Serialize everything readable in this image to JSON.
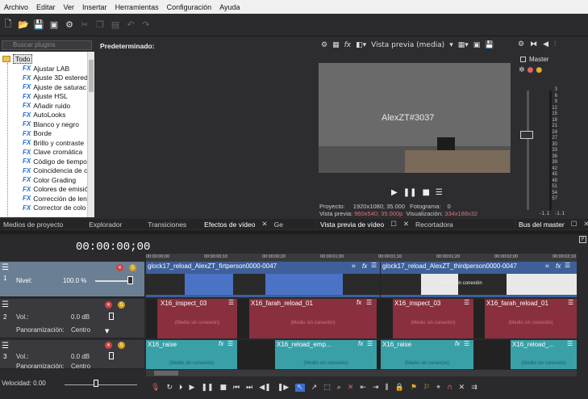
{
  "menu": [
    "Archivo",
    "Editar",
    "Ver",
    "Insertar",
    "Herramientas",
    "Configuración",
    "Ayuda"
  ],
  "plugins": {
    "search_placeholder": "Buscar plugins",
    "root": "Todo",
    "items": [
      "Ajustar LAB",
      "Ajuste 3D estered",
      "Ajuste de saturac",
      "Ajuste HSL",
      "Añadir ruido",
      "AutoLooks",
      "Blanco y negro",
      "Borde",
      "Brillo y contraste",
      "Clave cromática",
      "Código de tiempo",
      "Coincidencia de co",
      "Color Grading",
      "Colores de emisión",
      "Corrección de lent",
      "Corrector de colo"
    ],
    "preset": "Predeterminado:"
  },
  "left_tabs": [
    "Medios de proyecto",
    "Explorador",
    "Transiciones",
    "Efectos de vídeo",
    "Ge"
  ],
  "preview": {
    "mode": "Vista previa (media)",
    "overlay_text": "AlexZT#3037",
    "info": {
      "proyecto_label": "Proyecto:",
      "proyecto": "1920x1080; 35.000",
      "fotograma_label": "Fotograma:",
      "fotograma": "0",
      "vista_label": "Vista previa:",
      "vista": "960x540; 35.000p",
      "visual_label": "Visualización:",
      "visual": "334x188x32"
    },
    "tabs": [
      "Vista previa de vídeo",
      "Recortadora"
    ]
  },
  "master": {
    "label": "Master",
    "tab": "Bus del master",
    "scale": [
      "3",
      "6",
      "9",
      "12",
      "15",
      "18",
      "21",
      "24",
      "27",
      "30",
      "33",
      "36",
      "39",
      "42",
      "45",
      "48",
      "51",
      "54",
      "57"
    ],
    "foot": [
      "-1.1",
      "-1.1"
    ]
  },
  "timeline": {
    "timecode": "00:00:00;00",
    "ruler": [
      "00:00:00;00",
      "00:00:00;10",
      "00:00:00;20",
      "00:00:01;00",
      "00:00:01;10",
      "00:00:01;20",
      "00:00:02;00",
      "00:00:02;10"
    ],
    "tracks": {
      "video": {
        "num": "1",
        "label": "Nivel:",
        "value": "100.0 %"
      },
      "audio1": {
        "num": "2",
        "vol_label": "Vol.:",
        "vol": "0.0 dB",
        "pan_label": "Panoramización:",
        "pan": "Centro"
      },
      "audio2": {
        "num": "3",
        "vol_label": "Vol.:",
        "vol": "0.0 dB",
        "pan_label": "Panoramización:",
        "pan": "Centro"
      }
    },
    "clips": {
      "v1": "glock17_reload_AlexZT_firtperson0000-0047",
      "v2": "glock17_reload_AlexZT_thirdperson0000-0047",
      "a1": "X16_inspect_03",
      "a2": "X16_farah_reload_01",
      "a3": "X16_inspect_03",
      "a4": "X16_farah_reload_01",
      "b1": "X16_raise",
      "b2": "X16_reload_emp...",
      "b3": "X16_raise",
      "b4": "X16_reload_...",
      "offline": "(Medio sin conexión)",
      "offline_video": "Medio sin conexión"
    },
    "speed": "Velocidad: 0.00"
  }
}
